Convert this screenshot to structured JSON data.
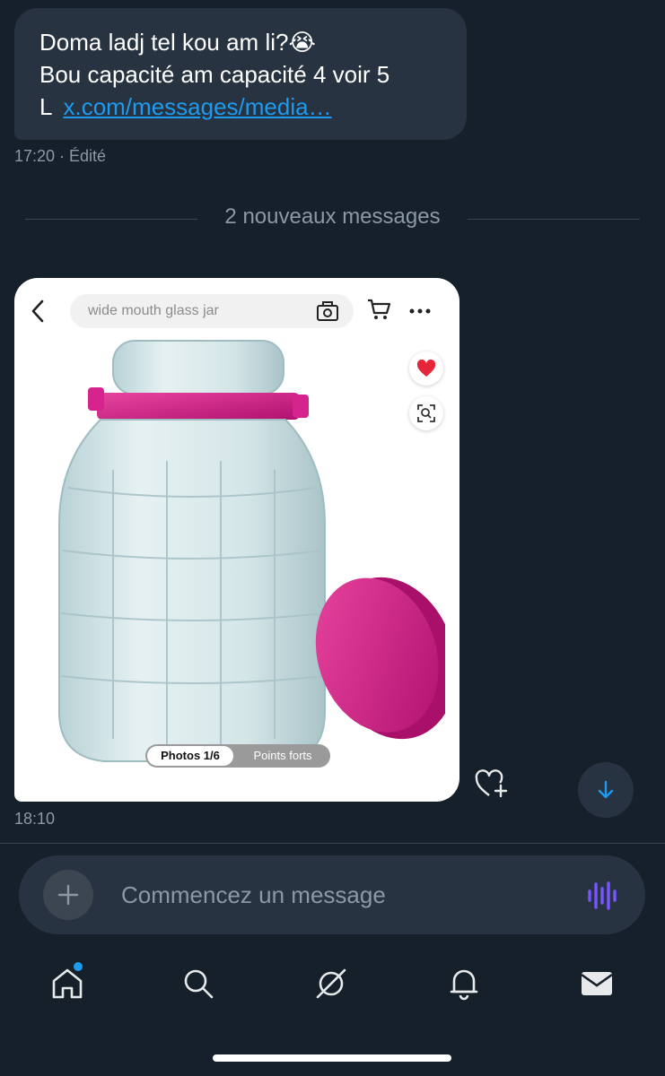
{
  "message_top": {
    "lines": [
      "Doma ladj tel kou am li?😭",
      "Bou capacité am capacité 4 voir 5"
    ],
    "prefix": "L",
    "link": "x.com/messages/media…",
    "meta": "17:20 · Édité"
  },
  "divider": {
    "label": "2 nouveaux messages"
  },
  "image_message": {
    "search_text": "wide mouth glass jar",
    "photos_tab": "Photos 1/6",
    "points_tab": "Points forts",
    "time": "18:10"
  },
  "composer": {
    "placeholder": "Commencez un message"
  },
  "tabbar": {
    "icons": [
      "home-icon",
      "search-icon",
      "grok-icon",
      "notifications-icon",
      "messages-icon"
    ]
  },
  "colors": {
    "accent": "#1d9bf0",
    "background": "#15202b",
    "bubble": "#273340",
    "lid": "#d6248e",
    "voice": "#7856ff"
  }
}
